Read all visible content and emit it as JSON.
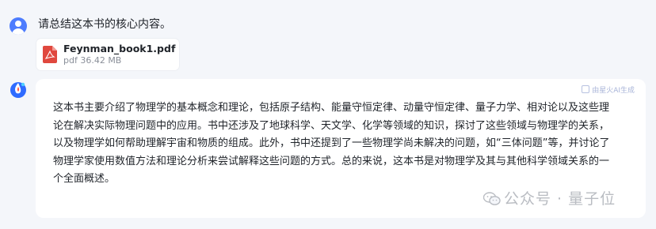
{
  "user": {
    "avatar_icon": "user-avatar-icon",
    "message": "请总结这本书的核心内容。"
  },
  "attachment": {
    "icon": "pdf-file-icon",
    "file_name": "Feynman_book1.pdf",
    "file_meta": "pdf 36.42 MB"
  },
  "assistant": {
    "avatar_icon": "assistant-logo-icon",
    "badge_label": "由星火AI生成",
    "answer_lines": [
      "这本书主要介绍了物理学的基本概念和理论，包括原子结构、能量守恒定律、动量守恒定律、量子力学、相对论以及这些理",
      "论在解决实际物理问题中的应用。书中还涉及了地球科学、天文学、化学等领域的知识，探讨了这些领域与物理学的关系，",
      "以及物理学如何帮助理解宇宙和物质的组成。此外，书中还提到了一些物理学尚未解决的问题，如“三体问题”等，并讨论了",
      "物理学家使用数值方法和理论分析来尝试解释这些问题的方式。总的来说，这本书是对物理学及其与其他科学领域关系的一",
      "个全面概述。"
    ]
  },
  "watermark": {
    "text": "公众号 · 量子位"
  },
  "colors": {
    "page_bg": "#f4f6fa",
    "user_avatar": "#4d7cfe",
    "pdf_red": "#e0483e",
    "assistant_blue": "#2f6bff"
  }
}
